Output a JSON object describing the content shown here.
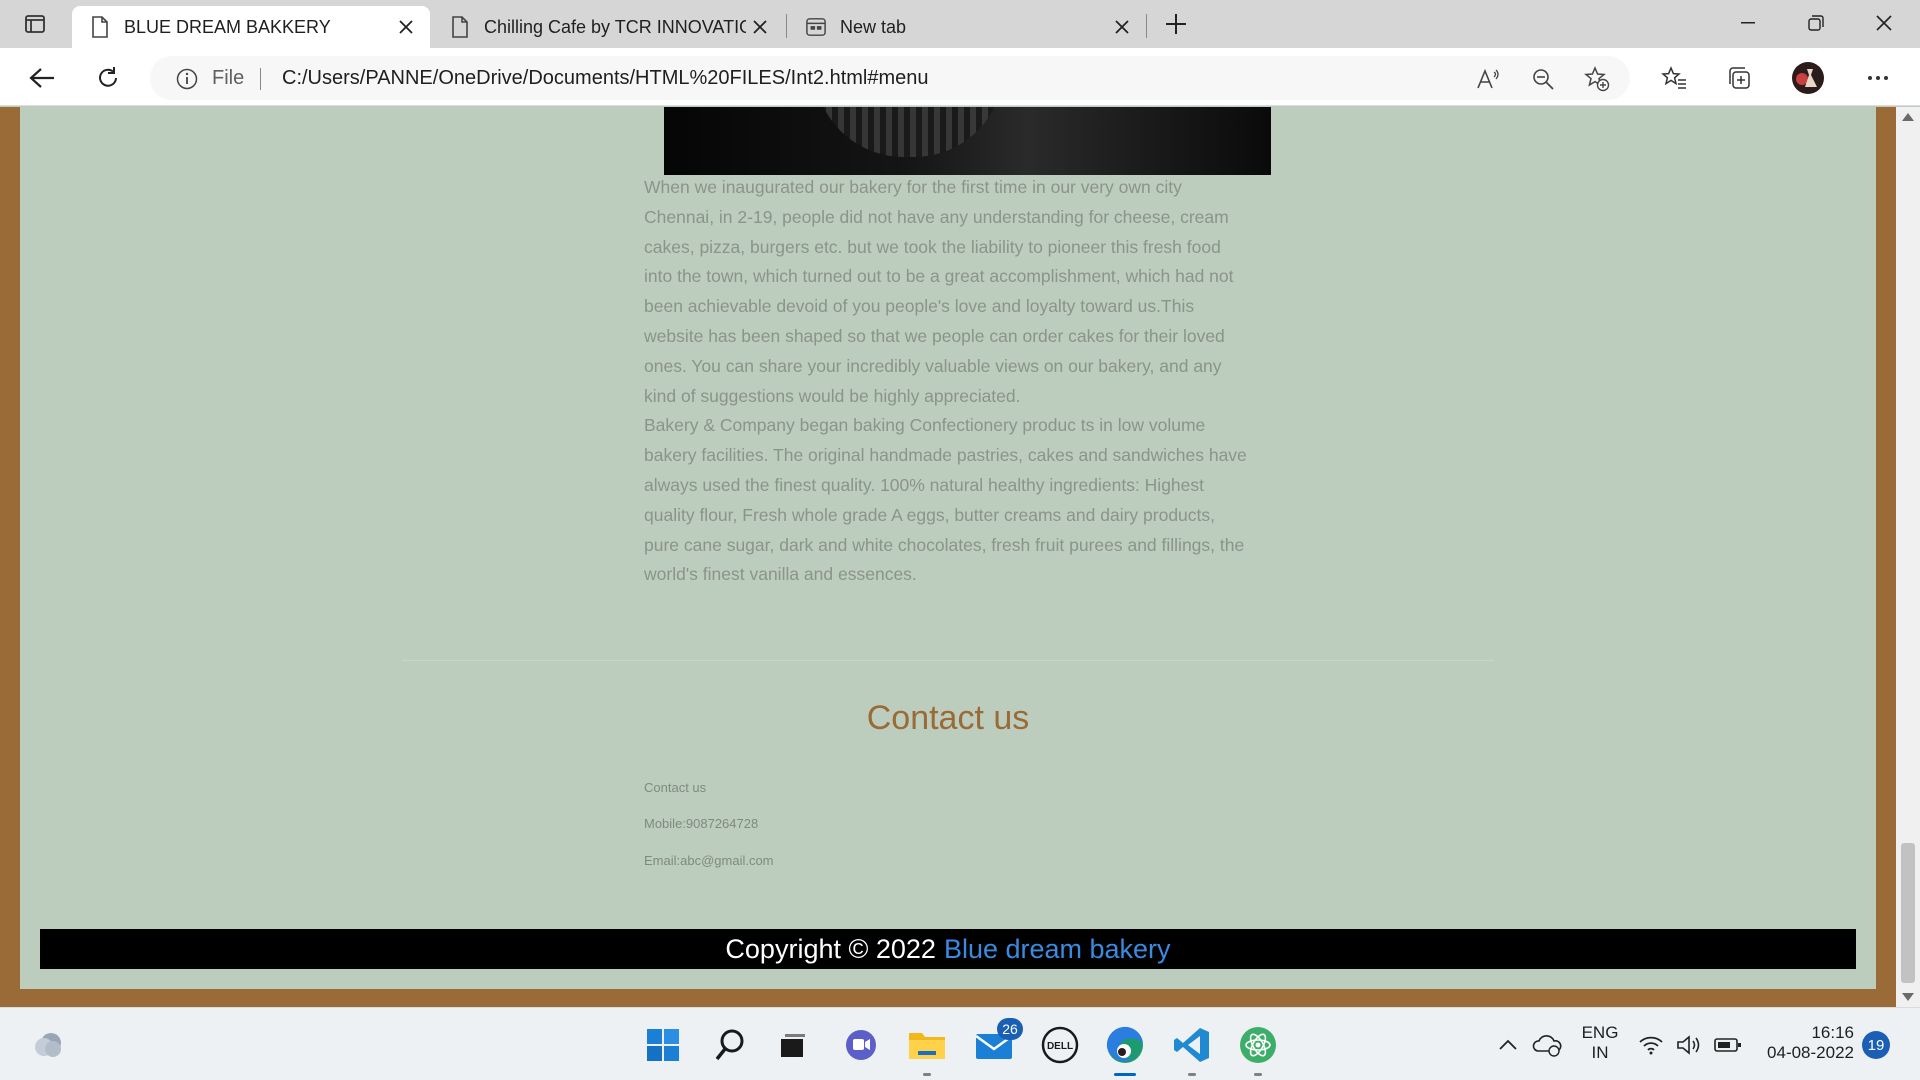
{
  "browser": {
    "tabs": [
      {
        "title": "BLUE DREAM BAKKERY",
        "active": true
      },
      {
        "title": "Chilling Cafe by TCR INNOVATIO",
        "active": false
      },
      {
        "title": "New tab",
        "active": false
      }
    ],
    "address": {
      "scheme": "File",
      "url": "C:/Users/PANNE/OneDrive/Documents/HTML%20FILES/Int2.html#menu"
    }
  },
  "page": {
    "about_paragraph_lines": [
      "When we inaugurated our bakery for the first time in our very own city",
      "Chennai, in 2-19, people did not have any understanding for cheese, cream",
      "cakes, pizza, burgers etc. but we took the liability to pioneer this fresh food",
      "into the town, which turned out to be a great accomplishment, which had not",
      "been achievable devoid of you people's love and loyalty toward us.This",
      "website has been shaped so that we people can order cakes for their loved",
      "ones. You can share your incredibly valuable views on our bakery, and any",
      "kind of suggestions would be highly appreciated.",
      "Bakery & Company began baking Confectionery produc ts in low volume",
      "bakery facilities. The original handmade pastries, cakes and sandwiches have",
      "always used the finest quality. 100% natural healthy ingredients: Highest",
      "quality flour, Fresh whole grade A eggs, butter creams and dairy products,",
      "pure cane sugar, dark and white chocolates, fresh fruit purees and fillings, the",
      "world's finest vanilla and essences."
    ],
    "contact": {
      "heading": "Contact us",
      "label": "Contact us",
      "mobile": "Mobile:9087264728",
      "email": "Email:abc@gmail.com"
    },
    "footer": {
      "copyright": "Copyright © 2022",
      "brand": "Blue dream bakery"
    }
  },
  "taskbar": {
    "mail_badge": "26",
    "tray": {
      "lang_top": "ENG",
      "lang_bottom": "IN",
      "time": "16:16",
      "date": "04-08-2022",
      "notifications": "19"
    }
  },
  "colors": {
    "page_background": "#bdcdbd",
    "frame_brown": "#9a6a37",
    "heading": "#9a6a37",
    "brand_link": "#3a8be0"
  }
}
